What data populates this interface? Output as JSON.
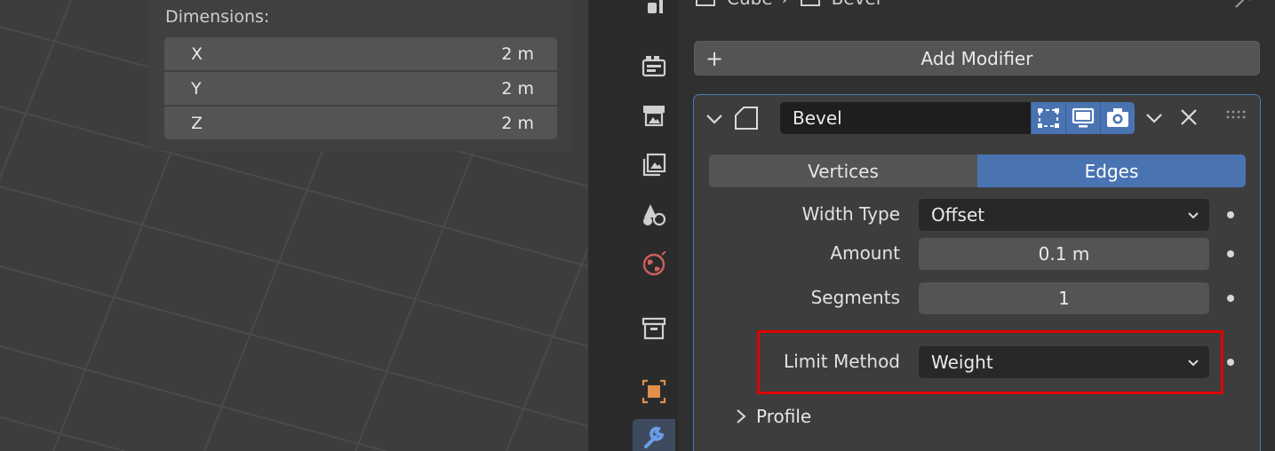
{
  "viewport": {
    "dimensions_title": "Dimensions:",
    "dimensions": [
      {
        "axis": "X",
        "value": "2 m"
      },
      {
        "axis": "Y",
        "value": "2 m"
      },
      {
        "axis": "Z",
        "value": "2 m"
      }
    ]
  },
  "tabs": {
    "icons": [
      "tool-icon",
      "render-icon",
      "output-icon",
      "view-layer-icon",
      "scene-icon",
      "world-icon",
      "collection-icon",
      "object-icon",
      "modifier-icon"
    ],
    "active": "modifier-icon"
  },
  "breadcrumb": {
    "object": "Cube",
    "separator": "›",
    "modifier": "Bevel"
  },
  "add_modifier_label": "Add Modifier",
  "modifier": {
    "name": "Bevel",
    "affect_options": [
      "Vertices",
      "Edges"
    ],
    "affect_selected": "Edges",
    "properties": {
      "width_type": {
        "label": "Width Type",
        "value": "Offset"
      },
      "amount": {
        "label": "Amount",
        "value": "0.1 m"
      },
      "segments": {
        "label": "Segments",
        "value": "1"
      },
      "limit_method": {
        "label": "Limit Method",
        "value": "Weight"
      }
    },
    "profile_label": "Profile"
  },
  "colors": {
    "accent": "#4a73b2",
    "panel_border": "#4a79b8",
    "highlight": "#e00000"
  }
}
